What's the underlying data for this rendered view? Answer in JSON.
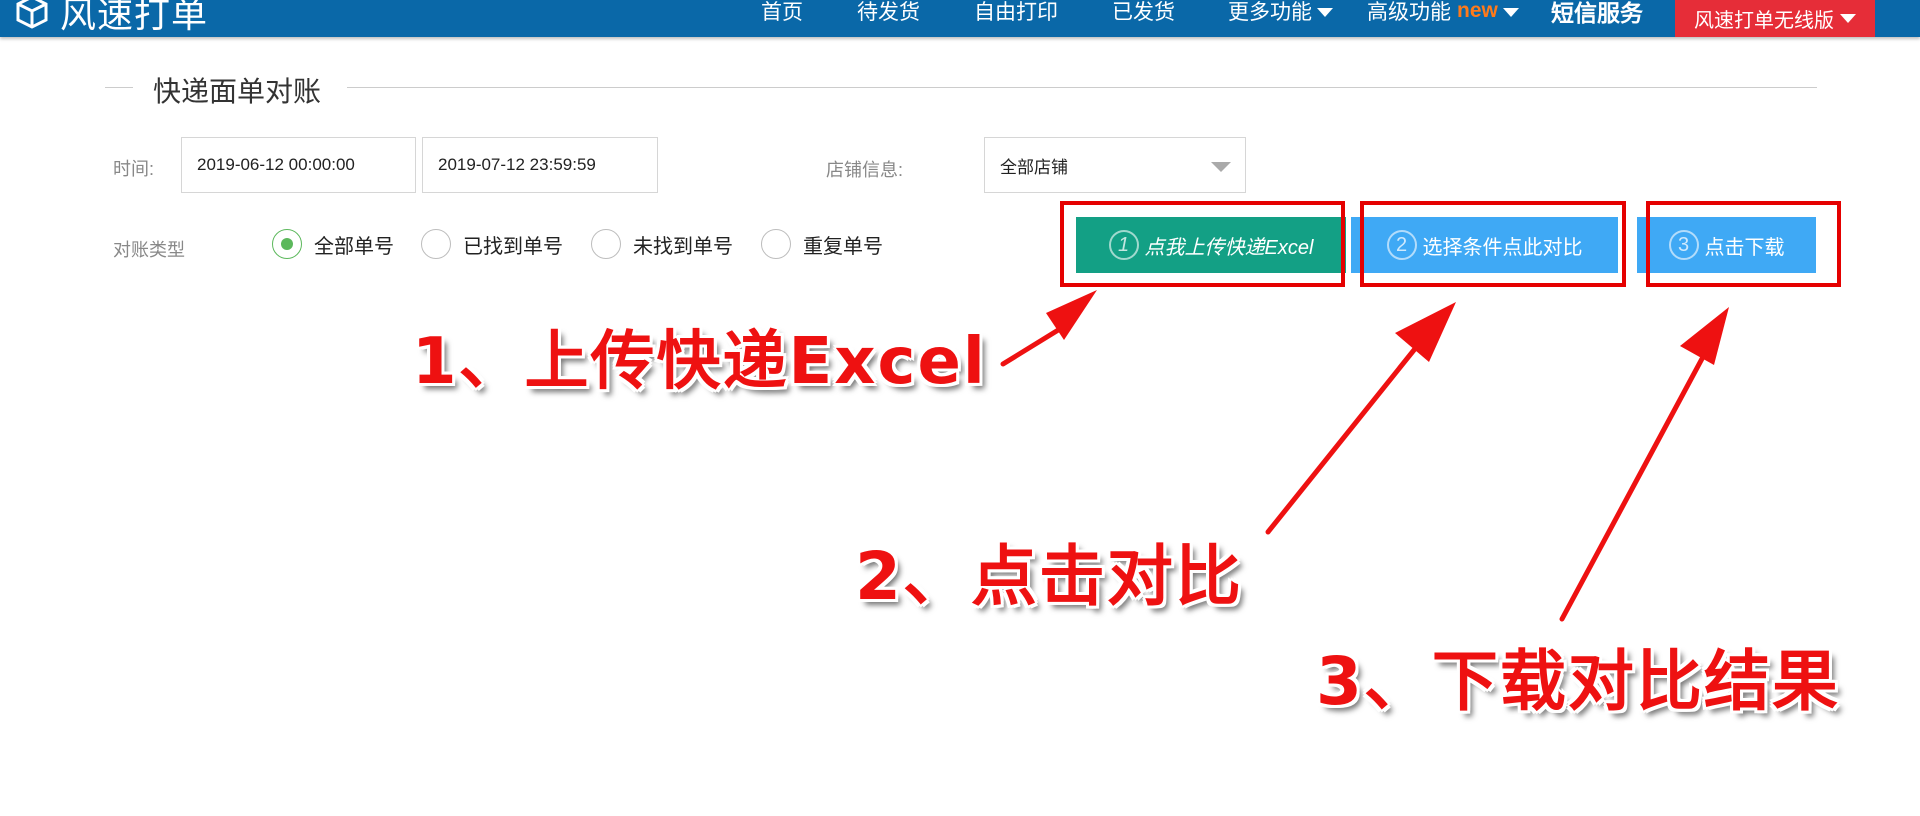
{
  "app": {
    "logo_text": "风速打单"
  },
  "nav": {
    "items": [
      {
        "label": "首页"
      },
      {
        "label": "待发货"
      },
      {
        "label": "自由打印"
      },
      {
        "label": "已发货"
      },
      {
        "label": "更多功能"
      },
      {
        "label": "高级功能"
      }
    ],
    "new_badge": "new",
    "sms_label": "短信服务",
    "offline_label": "风速打单无线版"
  },
  "page": {
    "section_title": "快递面单对账"
  },
  "form": {
    "time_label": "时间:",
    "start_time": "2019-06-12 00:00:00",
    "end_time": "2019-07-12 23:59:59",
    "shop_label": "店铺信息:",
    "shop_value": "全部店铺",
    "type_label": "对账类型",
    "radio_options": [
      {
        "label": "全部单号",
        "selected": true
      },
      {
        "label": "已找到单号",
        "selected": false
      },
      {
        "label": "未找到单号",
        "selected": false
      },
      {
        "label": "重复单号",
        "selected": false
      }
    ]
  },
  "actions": {
    "upload": {
      "num": "1",
      "label": "点我上传快递Excel"
    },
    "compare": {
      "num": "2",
      "label": "选择条件点此对比"
    },
    "download": {
      "num": "3",
      "label": "点击下载"
    }
  },
  "annotations": {
    "step1": "1、上传快递Excel",
    "step2": "2、点击对比",
    "step3": "3、下载对比结果"
  },
  "colors": {
    "nav_bg": "#0a68a8",
    "nav_red": "#e62d38",
    "upload_btn": "#13a085",
    "blue_btn": "#3fa9f5",
    "annotation": "#ee1111",
    "radio_on": "#5cb85c"
  }
}
